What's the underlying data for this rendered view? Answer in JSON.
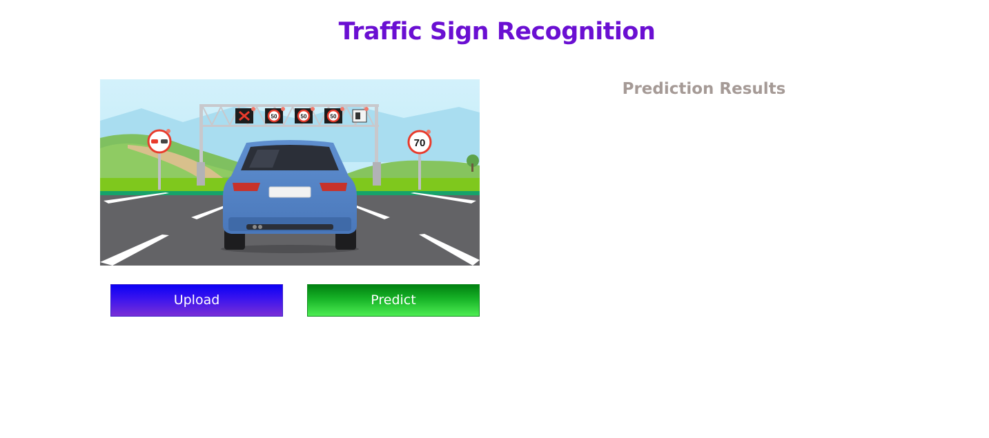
{
  "header": {
    "title": "Traffic Sign Recognition"
  },
  "image_panel": {
    "signs": {
      "left_side": "no-overtaking-sign",
      "right_side_value": "70",
      "gantry_speed_value": "50"
    }
  },
  "actions": {
    "upload_label": "Upload",
    "predict_label": "Predict"
  },
  "results": {
    "title": "Prediction Results"
  },
  "colors": {
    "title": "#6a0fd2",
    "results_title": "#a59a96",
    "upload_gradient": [
      "#0b00f5",
      "#7a2fd6"
    ],
    "predict_gradient": [
      "#008010",
      "#4ded52"
    ]
  }
}
